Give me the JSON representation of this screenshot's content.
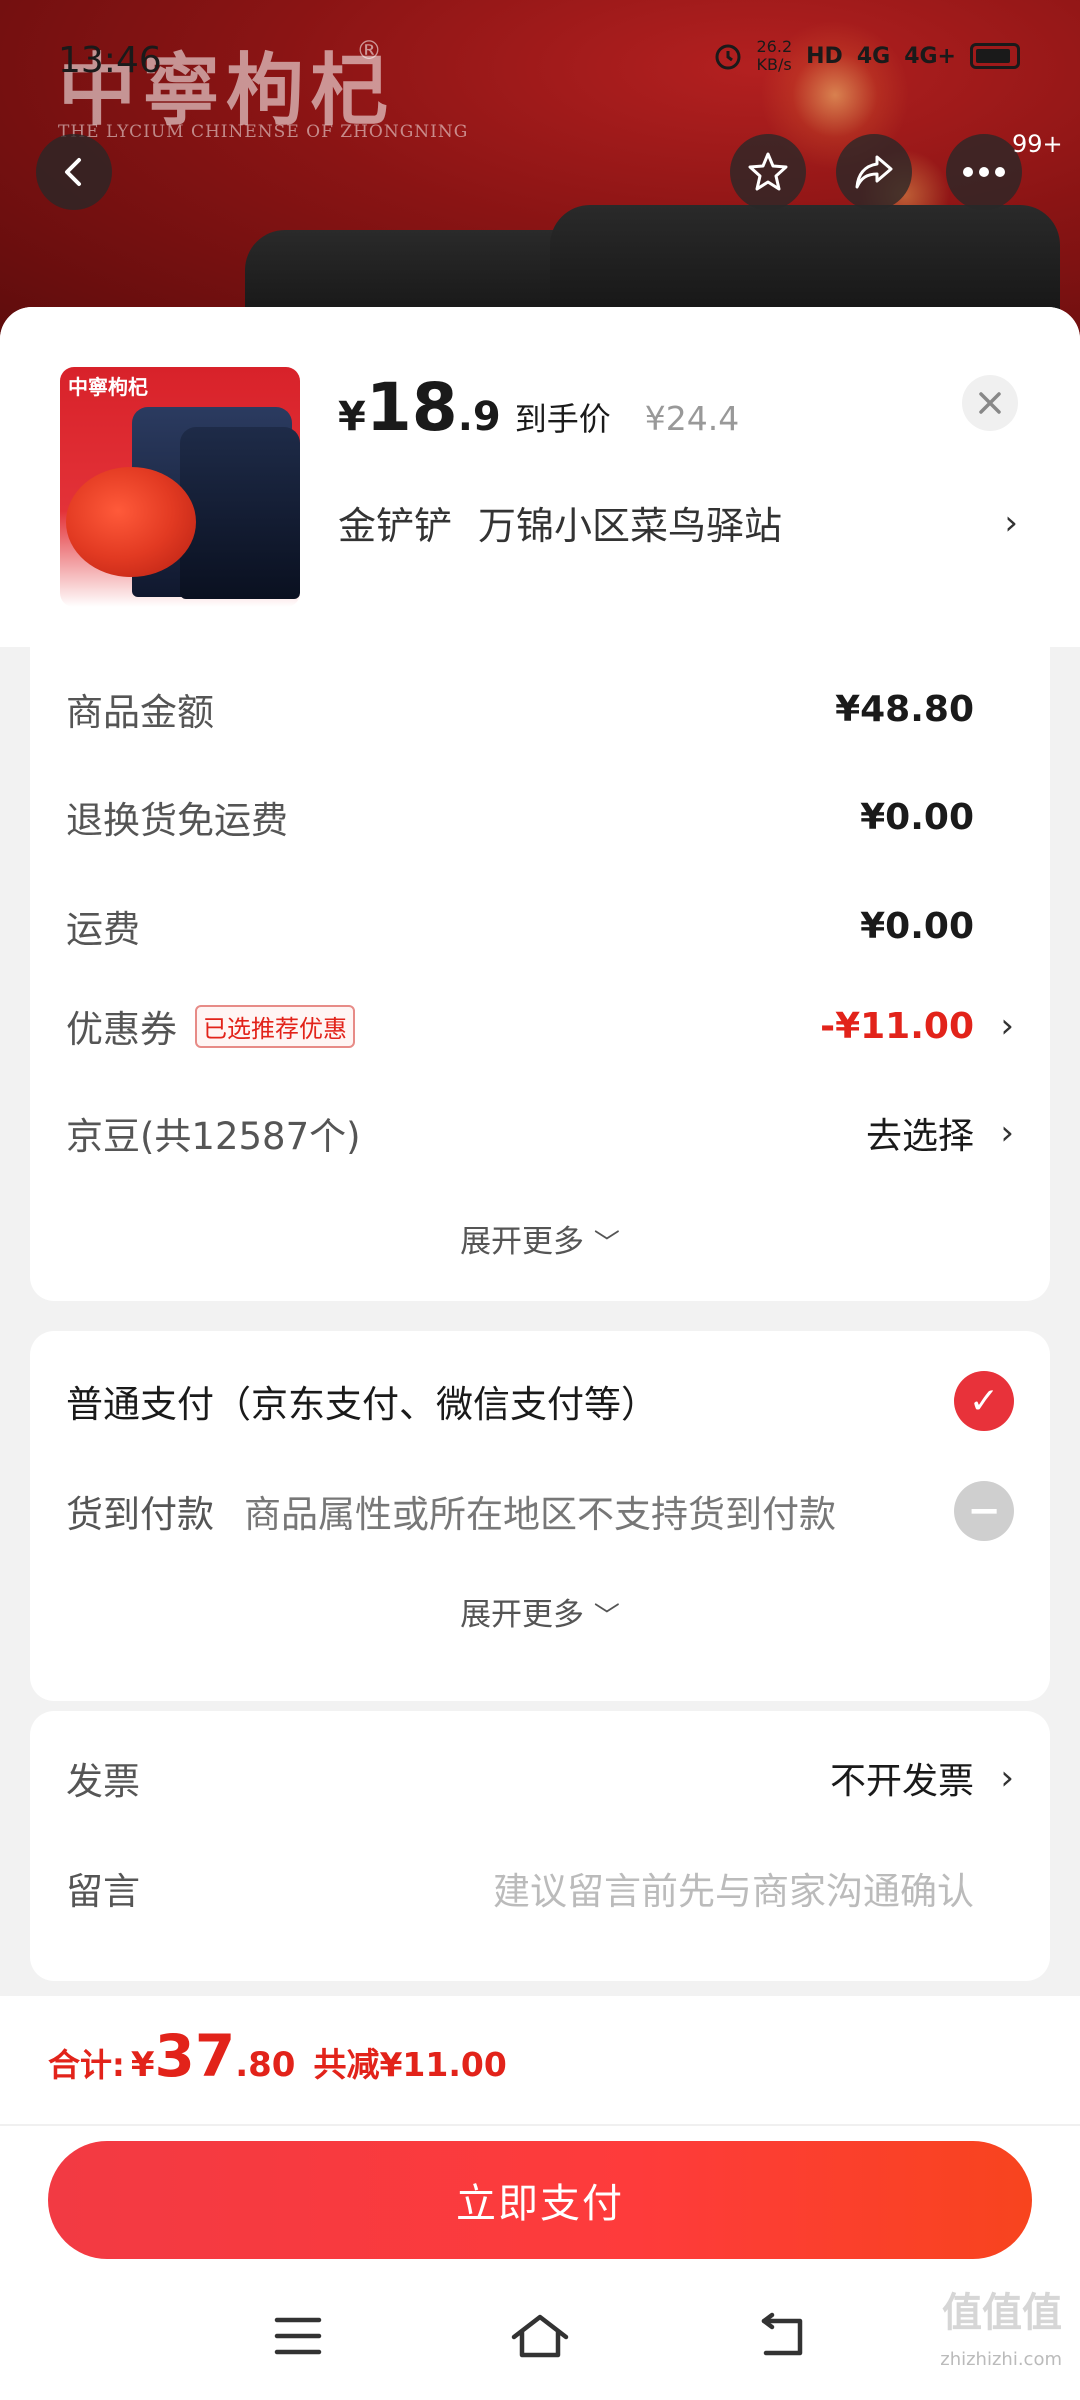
{
  "status_bar": {
    "time": "13:46",
    "net_speed": "26.2",
    "net_unit": "KB/s",
    "sim1": "4G",
    "sim2": "4G+"
  },
  "banner": {
    "brand": "中寧枸杞",
    "brand_reg": "®",
    "brand_sub": "THE LYCIUM CHINENSE OF ZHONGNING",
    "more_badge": "99+"
  },
  "product": {
    "thumb_label": "中寧枸杞",
    "price_symbol": "¥",
    "price_int": "18",
    "price_dec": ".9",
    "price_tag": "到手价",
    "price_original": "¥24.4",
    "address_name": "金铲铲",
    "address_text": "万锦小区菜鸟驿站"
  },
  "fees": {
    "goods_label": "商品金额",
    "goods_value": "¥48.80",
    "return_label": "退换货免运费",
    "return_value": "¥0.00",
    "shipping_label": "运费",
    "shipping_value": "¥0.00",
    "coupon_label": "优惠券",
    "coupon_tag": "已选推荐优惠",
    "coupon_value": "-¥11.00",
    "beans_label": "京豆(共12587个)",
    "beans_value": "去选择",
    "expand": "展开更多"
  },
  "payment": {
    "normal_label": "普通支付（京东支付、微信支付等）",
    "cod_label": "货到付款",
    "cod_desc": "商品属性或所在地区不支持货到付款",
    "expand": "展开更多"
  },
  "extras": {
    "invoice_label": "发票",
    "invoice_value": "不开发票",
    "note_label": "留言",
    "note_placeholder": "建议留言前先与商家沟通确认"
  },
  "footer": {
    "total_label": "合计:",
    "total_yen": "¥",
    "total_int": "37",
    "total_dec": ".80",
    "total_saving": "共减¥11.00",
    "pay_button": "立即支付"
  },
  "watermark": {
    "logo": "值值值",
    "url": "zhizhizhi.com"
  },
  "colors": {
    "accent_red": "#e2231a",
    "button_gradient_start": "#f23a43",
    "button_gradient_end": "#f8441e"
  }
}
